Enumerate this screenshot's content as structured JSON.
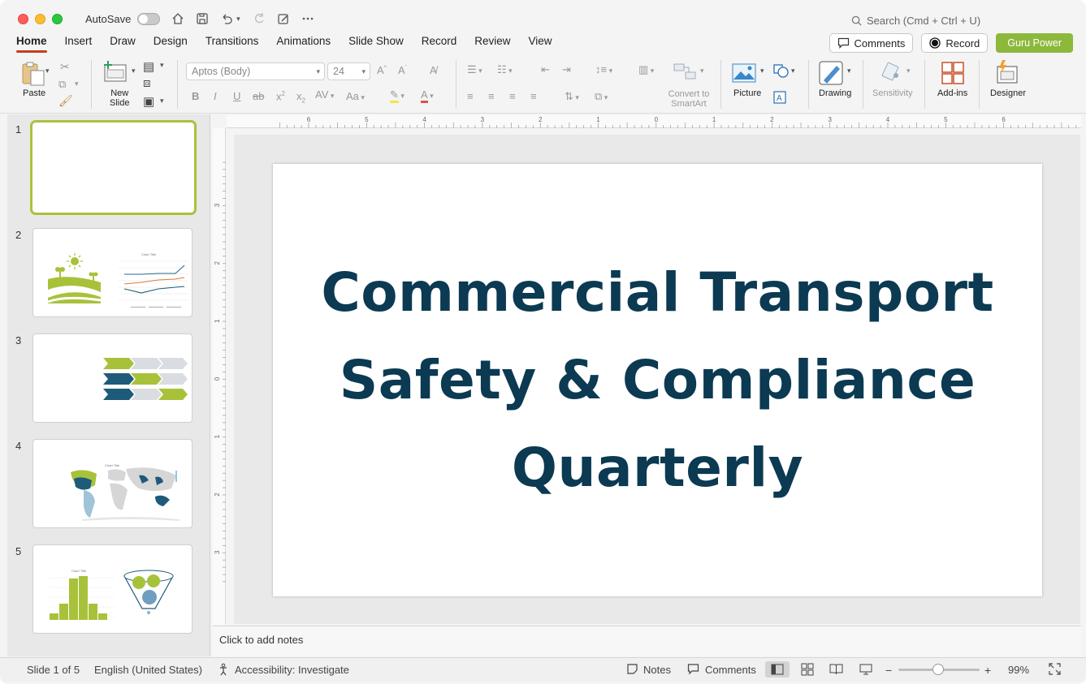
{
  "titlebar": {
    "autosave_label": "AutoSave",
    "search_placeholder": "Search (Cmd + Ctrl + U)"
  },
  "menu": {
    "tabs": [
      {
        "label": "Home",
        "active": true
      },
      {
        "label": "Insert"
      },
      {
        "label": "Draw"
      },
      {
        "label": "Design"
      },
      {
        "label": "Transitions"
      },
      {
        "label": "Animations"
      },
      {
        "label": "Slide Show"
      },
      {
        "label": "Record"
      },
      {
        "label": "Review"
      },
      {
        "label": "View"
      }
    ],
    "comments_label": "Comments",
    "record_label": "Record",
    "guru_label": "Guru Power"
  },
  "ribbon": {
    "paste_label": "Paste",
    "new_slide_label_1": "New",
    "new_slide_label_2": "Slide",
    "font_name": "Aptos (Body)",
    "font_size": "24",
    "convert_smartart_1": "Convert to",
    "convert_smartart_2": "SmartArt",
    "picture_label": "Picture",
    "drawing_label": "Drawing",
    "sensitivity_label": "Sensitivity",
    "addins_label": "Add-ins",
    "designer_label": "Designer"
  },
  "thumbnails": [
    {
      "number": "1"
    },
    {
      "number": "2",
      "chart_title": "Chart Title"
    },
    {
      "number": "3"
    },
    {
      "number": "4",
      "chart_title": "Chart Title"
    },
    {
      "number": "5",
      "chart_title": "Chart Title"
    }
  ],
  "slide": {
    "title_line_1": "Commercial Transport",
    "title_line_2": "Safety & Compliance",
    "title_line_3": "Quarterly"
  },
  "ruler": {
    "h_labels": [
      "6",
      "5",
      "4",
      "3",
      "2",
      "1",
      "0",
      "1",
      "2",
      "3",
      "4",
      "5",
      "6"
    ],
    "v_labels": [
      "3",
      "2",
      "1",
      "0",
      "1",
      "2",
      "3"
    ]
  },
  "notes": {
    "placeholder": "Click to add notes"
  },
  "status": {
    "slide_info": "Slide 1 of 5",
    "language": "English (United States)",
    "accessibility": "Accessibility: Investigate",
    "notes_label": "Notes",
    "comments_label": "Comments",
    "zoom": "99%"
  },
  "colors": {
    "accent_tab": "#c43e1c",
    "guru_button": "#8cb83c",
    "slide_title": "#0b3a52",
    "selected_thumb_border": "#a9c23c"
  }
}
